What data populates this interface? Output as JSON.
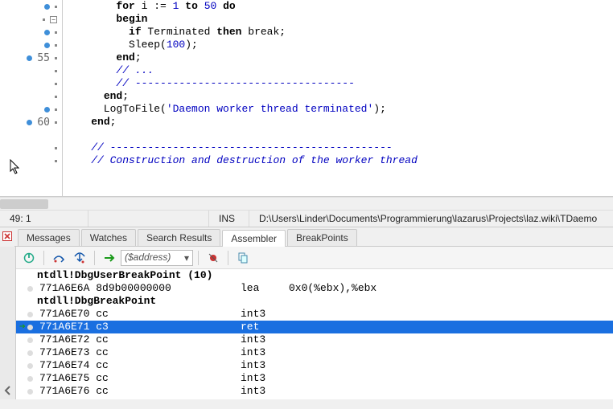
{
  "editor": {
    "lines": [
      {
        "ln": "",
        "bp": true,
        "dot": true,
        "fold": "",
        "frags": [
          {
            "t": "        ",
            "c": ""
          },
          {
            "t": "for",
            "c": "kw"
          },
          {
            "t": " i := ",
            "c": "id"
          },
          {
            "t": "1",
            "c": "num"
          },
          {
            "t": " ",
            "c": ""
          },
          {
            "t": "to",
            "c": "kw"
          },
          {
            "t": " ",
            "c": ""
          },
          {
            "t": "50",
            "c": "num"
          },
          {
            "t": " ",
            "c": ""
          },
          {
            "t": "do",
            "c": "kw"
          }
        ]
      },
      {
        "ln": "",
        "bp": false,
        "dot": true,
        "fold": "-",
        "frags": [
          {
            "t": "        ",
            "c": ""
          },
          {
            "t": "begin",
            "c": "kw"
          }
        ]
      },
      {
        "ln": "",
        "bp": true,
        "dot": true,
        "fold": "",
        "frags": [
          {
            "t": "          ",
            "c": ""
          },
          {
            "t": "if",
            "c": "kw"
          },
          {
            "t": " Terminated ",
            "c": "id"
          },
          {
            "t": "then",
            "c": "kw"
          },
          {
            "t": " break;",
            "c": "id"
          }
        ]
      },
      {
        "ln": "",
        "bp": true,
        "dot": true,
        "fold": "",
        "frags": [
          {
            "t": "          Sleep(",
            "c": "id"
          },
          {
            "t": "100",
            "c": "num"
          },
          {
            "t": ");",
            "c": "id"
          }
        ]
      },
      {
        "ln": "55",
        "bp": true,
        "dot": true,
        "fold": "",
        "frags": [
          {
            "t": "        ",
            "c": ""
          },
          {
            "t": "end",
            "c": "kw"
          },
          {
            "t": ";",
            "c": "id"
          }
        ]
      },
      {
        "ln": "",
        "bp": false,
        "dot": true,
        "fold": "",
        "frags": [
          {
            "t": "        ",
            "c": ""
          },
          {
            "t": "// ...",
            "c": "cmt"
          }
        ]
      },
      {
        "ln": "",
        "bp": false,
        "dot": true,
        "fold": "",
        "frags": [
          {
            "t": "        ",
            "c": ""
          },
          {
            "t": "// -----------------------------------",
            "c": "cmt"
          }
        ]
      },
      {
        "ln": "",
        "bp": false,
        "dot": true,
        "fold": "",
        "frags": [
          {
            "t": "      ",
            "c": ""
          },
          {
            "t": "end",
            "c": "kw"
          },
          {
            "t": ";",
            "c": "id"
          }
        ]
      },
      {
        "ln": "",
        "bp": true,
        "dot": true,
        "fold": "",
        "frags": [
          {
            "t": "      LogToFile(",
            "c": "id"
          },
          {
            "t": "'Daemon worker thread terminated'",
            "c": "str"
          },
          {
            "t": ");",
            "c": "id"
          }
        ]
      },
      {
        "ln": "60",
        "bp": true,
        "dot": true,
        "fold": "",
        "frags": [
          {
            "t": "    ",
            "c": ""
          },
          {
            "t": "end",
            "c": "kw"
          },
          {
            "t": ";",
            "c": "id"
          }
        ]
      },
      {
        "ln": "",
        "bp": false,
        "dot": false,
        "fold": "",
        "frags": [
          {
            "t": "",
            "c": ""
          }
        ]
      },
      {
        "ln": "",
        "bp": false,
        "dot": true,
        "fold": "",
        "frags": [
          {
            "t": "    ",
            "c": ""
          },
          {
            "t": "// ---------------------------------------------",
            "c": "cmt"
          }
        ]
      },
      {
        "ln": "",
        "bp": false,
        "dot": true,
        "fold": "",
        "frags": [
          {
            "t": "    ",
            "c": ""
          },
          {
            "t": "// Construction and destruction of the worker thread",
            "c": "cmt"
          }
        ]
      }
    ]
  },
  "status": {
    "pos": "49: 1",
    "mode": "INS",
    "path": "D:\\Users\\Linder\\Documents\\Programmierung\\lazarus\\Projects\\laz.wiki\\TDaemo"
  },
  "tabs": {
    "items": [
      "Messages",
      "Watches",
      "Search Results",
      "Assembler",
      "BreakPoints"
    ],
    "active": 3
  },
  "toolbar": {
    "combo_placeholder": "($address)"
  },
  "asm": {
    "rows": [
      {
        "type": "hdr",
        "text": "ntdll!DbgUserBreakPoint (10)"
      },
      {
        "type": "ins",
        "addr": "771A6E6A",
        "bytes": "8d9b00000000",
        "mn": "lea",
        "ops": "0x0(%ebx),%ebx"
      },
      {
        "type": "hdr",
        "text": "ntdll!DbgBreakPoint"
      },
      {
        "type": "ins",
        "addr": "771A6E70",
        "bytes": "cc",
        "mn": "int3",
        "ops": ""
      },
      {
        "type": "ins",
        "addr": "771A6E71",
        "bytes": "c3",
        "mn": "ret",
        "ops": "",
        "cur": true,
        "sel": true
      },
      {
        "type": "ins",
        "addr": "771A6E72",
        "bytes": "cc",
        "mn": "int3",
        "ops": ""
      },
      {
        "type": "ins",
        "addr": "771A6E73",
        "bytes": "cc",
        "mn": "int3",
        "ops": ""
      },
      {
        "type": "ins",
        "addr": "771A6E74",
        "bytes": "cc",
        "mn": "int3",
        "ops": ""
      },
      {
        "type": "ins",
        "addr": "771A6E75",
        "bytes": "cc",
        "mn": "int3",
        "ops": ""
      },
      {
        "type": "ins",
        "addr": "771A6E76",
        "bytes": "cc",
        "mn": "int3",
        "ops": ""
      }
    ]
  }
}
